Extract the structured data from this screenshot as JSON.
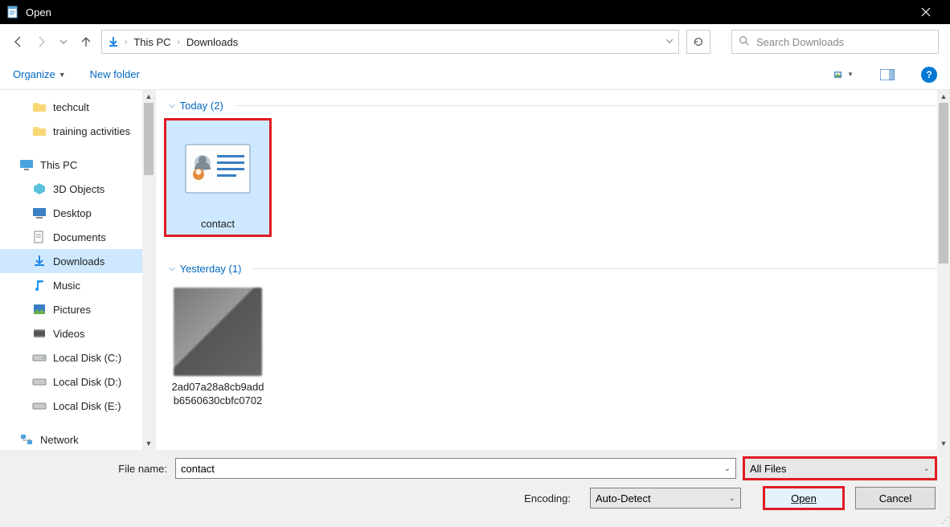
{
  "window": {
    "title": "Open"
  },
  "breadcrumb": {
    "root": "This PC",
    "current": "Downloads"
  },
  "search": {
    "placeholder": "Search Downloads"
  },
  "toolbar": {
    "organize": "Organize",
    "newfolder": "New folder"
  },
  "sidebar": {
    "folders": [
      "techcult",
      "training activities"
    ],
    "root": "This PC",
    "items": [
      "3D Objects",
      "Desktop",
      "Documents",
      "Downloads",
      "Music",
      "Pictures",
      "Videos",
      "Local Disk (C:)",
      "Local Disk (D:)",
      "Local Disk (E:)"
    ],
    "network": "Network"
  },
  "groups": [
    {
      "label": "Today (2)",
      "files": [
        {
          "name": "contact",
          "selected": true,
          "type": "contact"
        }
      ]
    },
    {
      "label": "Yesterday (1)",
      "files": [
        {
          "name": "2ad07a28a8cb9addb6560630cbfc0702",
          "selected": false,
          "type": "photo"
        }
      ]
    }
  ],
  "footer": {
    "filename_label": "File name:",
    "filename_value": "contact",
    "encoding_label": "Encoding:",
    "encoding_value": "Auto-Detect",
    "filter_value": "All Files",
    "open": "Open",
    "cancel": "Cancel"
  }
}
